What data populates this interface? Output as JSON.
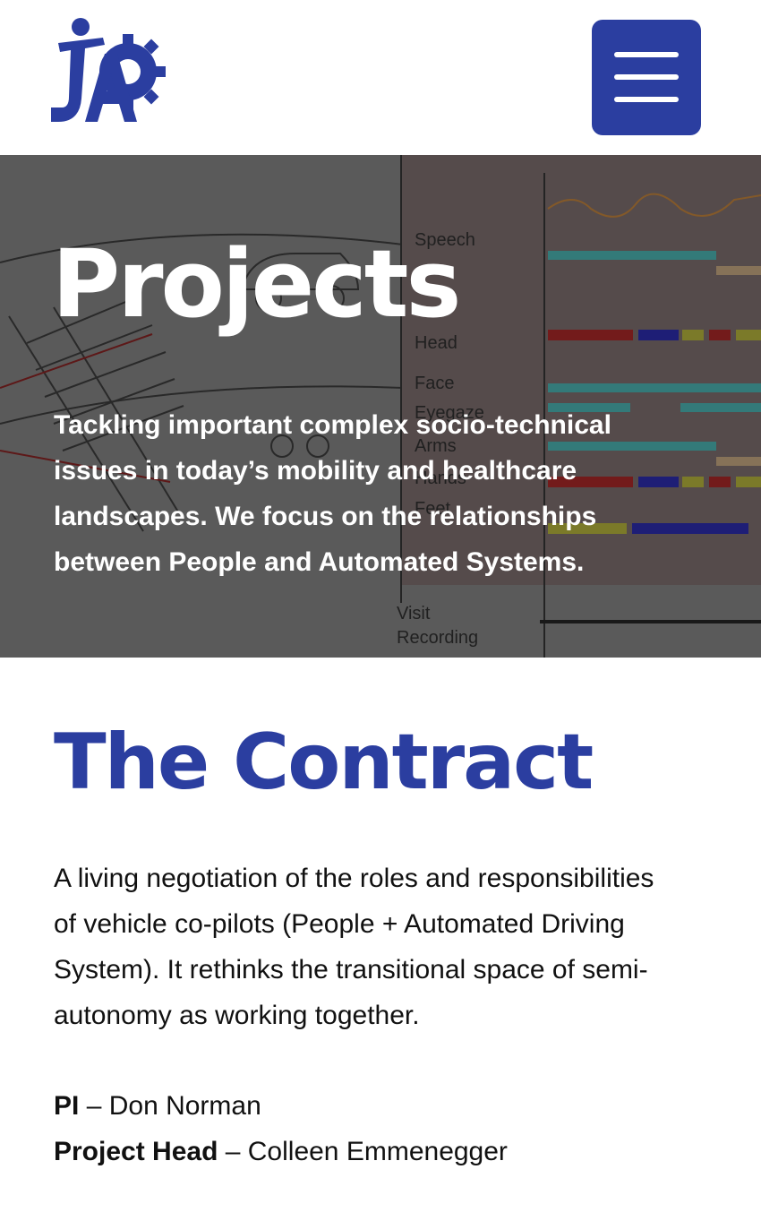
{
  "header": {
    "logo_alt": "JAP logo",
    "menu_icon": "hamburger-menu-icon",
    "brand_color": "#2b3ea0"
  },
  "hero": {
    "title": "Projects",
    "subtitle": "Tackling important complex socio-technical issues in today’s mobility and healthcare landscapes. We focus on the relationships between People and Automated Systems.",
    "bg_labels": {
      "speech": "Speech",
      "head": "Head",
      "face": "Face",
      "eyegaze": "Eyegaze",
      "arms": "Arms",
      "hands": "Hands",
      "feet": "Feet",
      "visit": "Visit",
      "recording": "Recording"
    }
  },
  "project": {
    "title": "The Contract",
    "description": "A living negotiation of the roles and responsibilities of vehicle co-pilots (People + Automated Driving System). It rethinks the transitional space of semi-autonomy as working together.",
    "pi_label": "PI",
    "pi_name": " – Don Norman",
    "head_label": "Project Head",
    "head_name": " – Colleen Emmenegger"
  }
}
